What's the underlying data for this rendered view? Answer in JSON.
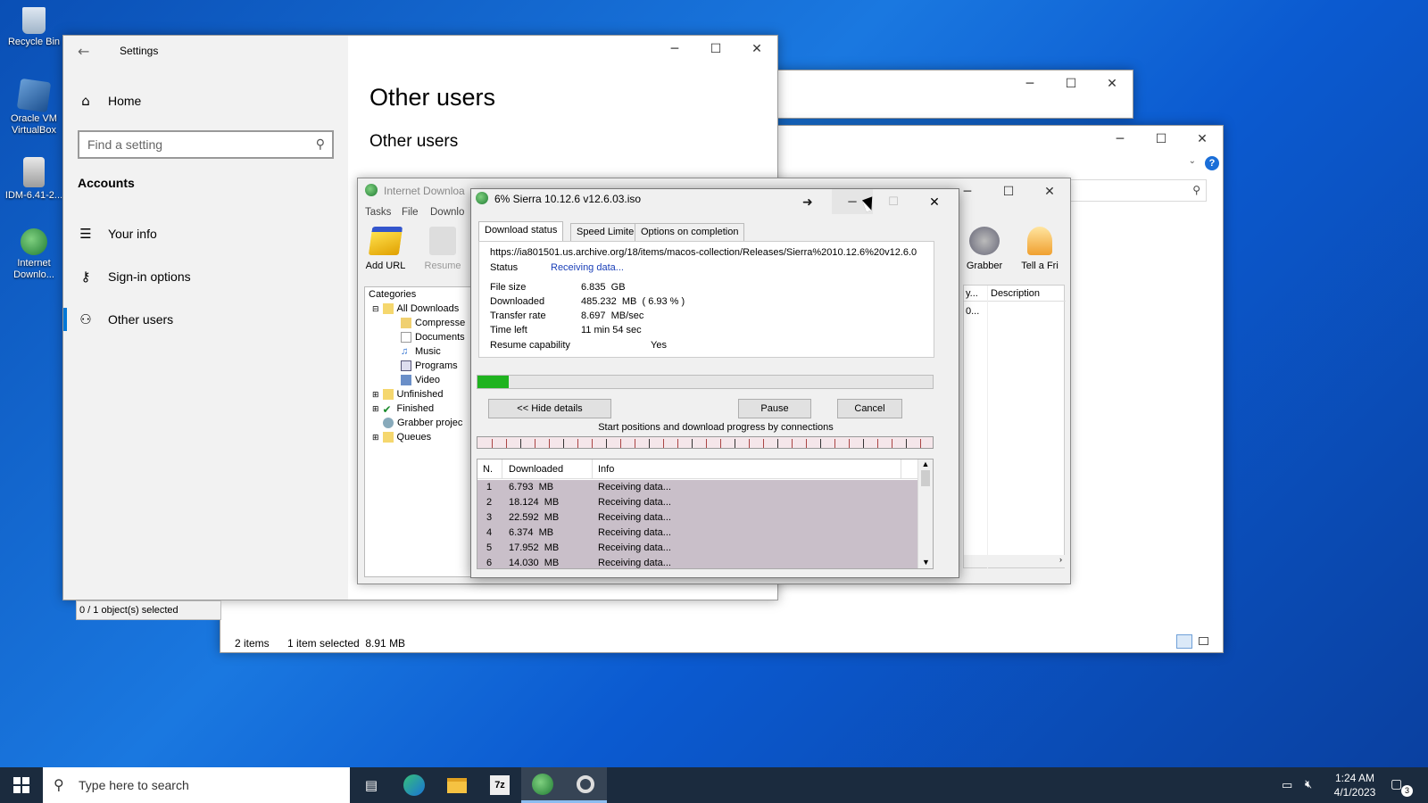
{
  "desktop": {
    "icons": [
      {
        "label": "Recycle Bin"
      },
      {
        "label": "Oracle VM VirtualBox"
      },
      {
        "label": "IDM-6.41-2..."
      },
      {
        "label": "Internet Downlo..."
      }
    ]
  },
  "settings": {
    "title": "Settings",
    "home": "Home",
    "search_placeholder": "Find a setting",
    "section": "Accounts",
    "nav": [
      "Your info",
      "Sign-in options",
      "Other users"
    ],
    "page_title": "Other users",
    "sub_title": "Other users"
  },
  "explorer": {
    "status_left": "0 / 1 object(s) selected",
    "items": "2 items",
    "selected": "1 item selected  8.91 MB"
  },
  "idm": {
    "title": "Internet Downloa",
    "menu": [
      "Tasks",
      "File",
      "Downlo"
    ],
    "toolbar": [
      "Add URL",
      "Resume",
      "Grabber",
      "Tell a Fri"
    ],
    "categories_label": "Categories",
    "tree": [
      "All Downloads",
      "Compresse",
      "Documents",
      "Music",
      "Programs",
      "Video",
      "Unfinished",
      "Finished",
      "Grabber projec",
      "Queues"
    ],
    "col_partial": "y...",
    "col_description": "Description",
    "cell_partial": "0..."
  },
  "download": {
    "title": "6% Sierra 10.12.6 v12.6.03.iso",
    "tabs": [
      "Download status",
      "Speed Limiter",
      "Options on completion"
    ],
    "url": "https://ia801501.us.archive.org/18/items/macos-collection/Releases/Sierra%2010.12.6%20v12.6.0",
    "status_label": "Status",
    "status_value": "Receiving data...",
    "file_size_label": "File size",
    "file_size": "6.835  GB",
    "downloaded_label": "Downloaded",
    "downloaded": "485.232  MB  ( 6.93 % )",
    "rate_label": "Transfer rate",
    "rate": "8.697  MB/sec",
    "time_label": "Time left",
    "time": "11 min 54 sec",
    "resume_label": "Resume capability",
    "resume": "Yes",
    "progress": 0.0693,
    "hide_details": "<< Hide details",
    "pause": "Pause",
    "cancel": "Cancel",
    "connections_caption": "Start positions and download progress by connections",
    "table_headers": [
      "N.",
      "Downloaded",
      "Info"
    ],
    "rows": [
      {
        "n": "1",
        "dl": "6.793  MB",
        "info": "Receiving data..."
      },
      {
        "n": "2",
        "dl": "18.124  MB",
        "info": "Receiving data..."
      },
      {
        "n": "3",
        "dl": "22.592  MB",
        "info": "Receiving data..."
      },
      {
        "n": "4",
        "dl": "6.374  MB",
        "info": "Receiving data..."
      },
      {
        "n": "5",
        "dl": "17.952  MB",
        "info": "Receiving data..."
      },
      {
        "n": "6",
        "dl": "14.030  MB",
        "info": "Receiving data..."
      }
    ]
  },
  "taskbar": {
    "search_placeholder": "Type here to search",
    "time": "1:24 AM",
    "date": "4/1/2023",
    "notifications": "3"
  },
  "colors": {
    "accent": "#0078d7",
    "progress": "#1fb31f",
    "status_blue": "#1a3fb8",
    "row_bg": "#c9bfc9"
  }
}
